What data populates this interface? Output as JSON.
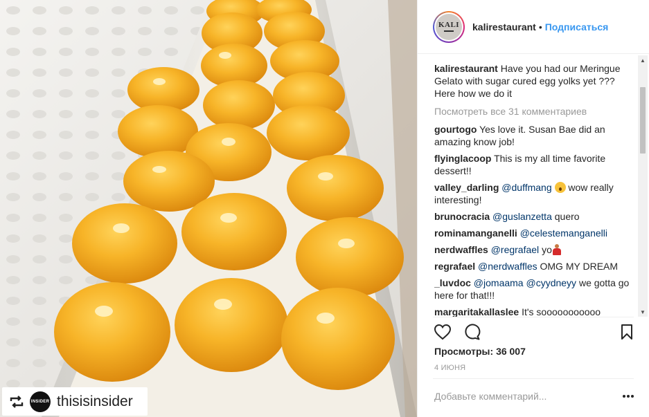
{
  "post": {
    "username": "kalirestaurant",
    "dot": "•",
    "follow_label": "Подписаться",
    "avatar_logo": "KALI",
    "caption_user": "kalirestaurant",
    "caption_text": "Have you had our Meringue Gelato with sugar cured egg yolks yet ??? Here how we do it",
    "view_all": "Посмотреть все 31 комментариев"
  },
  "repost": {
    "icon": "repost-icon",
    "avatar_text": "INSIDER",
    "name": "thisisinsider"
  },
  "comments": [
    {
      "user": "gourtogo",
      "text": "Yes love it. Susan Bae did an amazing know job!"
    },
    {
      "user": "flyinglacoop",
      "text": "This is my all time favorite dessert!!"
    },
    {
      "user": "valley_darling",
      "mention": "@duffmang",
      "text": "wow really interesting!"
    },
    {
      "user": "brunocracia",
      "mention": "@guslanzetta",
      "text": "quero"
    },
    {
      "user": "rominamanganelli",
      "mention": "@celestemanganelli",
      "text": ""
    },
    {
      "user": "nerdwaffles",
      "mention": "@regrafael",
      "text": "yo"
    },
    {
      "user": "regrafael",
      "mention": "@nerdwaffles",
      "text": "OMG MY DREAM"
    },
    {
      "user": "_luvdoc",
      "mention": "@jomaama",
      "mention2": "@cyydneyy",
      "text": "we gotta go here for that!!!"
    },
    {
      "user": "margaritakallaslee",
      "text": "It's sooooooooooo"
    }
  ],
  "actions": {
    "like_icon": "heart-icon",
    "comment_icon": "comment-icon",
    "save_icon": "bookmark-icon"
  },
  "stats": {
    "views_label": "Просмотры:",
    "views_value": "36 007",
    "date": "4 ИЮНЯ"
  },
  "add_comment": {
    "placeholder": "Добавьте комментарий..."
  },
  "colors": {
    "link": "#3897f0",
    "mention": "#003569",
    "muted": "#999999",
    "yolk": "#f2a21c"
  }
}
